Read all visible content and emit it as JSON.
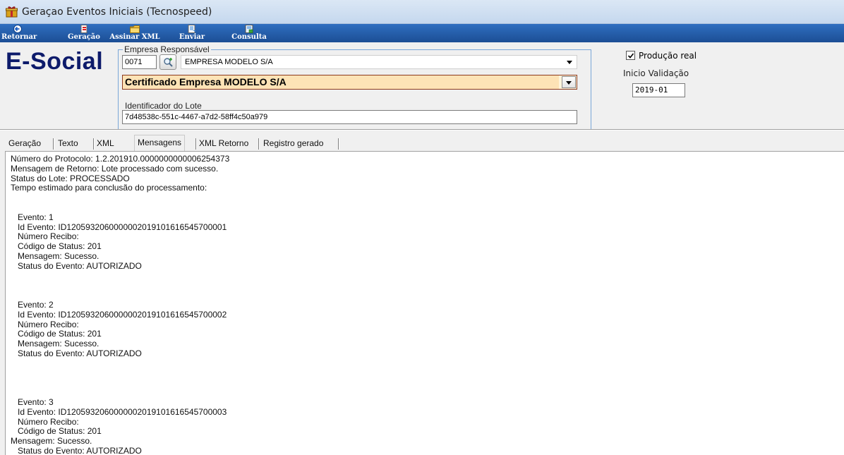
{
  "window": {
    "title": "Geraçao Eventos Iniciais (Tecnospeed)",
    "icon": "gift-box-icon"
  },
  "toolbar": {
    "buttons": [
      {
        "label": "Retornar",
        "icon": "back-arrow-icon"
      },
      {
        "label": "Geração",
        "icon": "document-icon"
      },
      {
        "label": "Assinar XML",
        "icon": "folder-icon"
      },
      {
        "label": "Enviar",
        "icon": "send-document-icon"
      },
      {
        "label": "Consulta",
        "icon": "query-document-icon"
      }
    ]
  },
  "logo": {
    "text": "E-Social"
  },
  "empresa": {
    "legend": "Empresa Responsável",
    "code": "0071",
    "company": "EMPRESA MODELO S/A",
    "certificate": "Certificado Empresa MODELO S/A",
    "lot_label": "Identificador do Lote",
    "lot_id": "7d48538c-551c-4467-a7d2-58ff4c50a979"
  },
  "settings": {
    "production_label": "Produção real",
    "production_checked": true,
    "validity_label": "Inicio Validação",
    "validity_value": "2019-01"
  },
  "tabs": [
    "Geração",
    "Texto",
    "XML",
    "Mensagens",
    "XML Retorno",
    "Registro gerado"
  ],
  "active_tab": "Mensagens",
  "messages": "Número do Protocolo: 1.2.201910.0000000000006254373\nMensagem de Retorno: Lote processado com sucesso.\nStatus do Lote: PROCESSADO\nTempo estimado para conclusão do processamento:\n\n\n   Evento: 1\n   Id Evento: ID1205932060000002019101616545700001\n   Número Recibo:\n   Código de Status: 201\n   Mensagem: Sucesso.\n   Status do Evento: AUTORIZADO\n\n\n\n   Evento: 2\n   Id Evento: ID1205932060000002019101616545700002\n   Número Recibo:\n   Código de Status: 201\n   Mensagem: Sucesso.\n   Status do Evento: AUTORIZADO\n\n\n\n\n   Evento: 3\n   Id Evento: ID1205932060000002019101616545700003\n   Número Recibo:\n   Código de Status: 201\nMensagem: Sucesso.\n   Status do Evento: AUTORIZADO",
  "colors": {
    "toolbar": "#2a63b0",
    "logo": "#0d1b6b",
    "certificate_bg": "#fde3b6",
    "group_border": "#7aa7d8"
  }
}
